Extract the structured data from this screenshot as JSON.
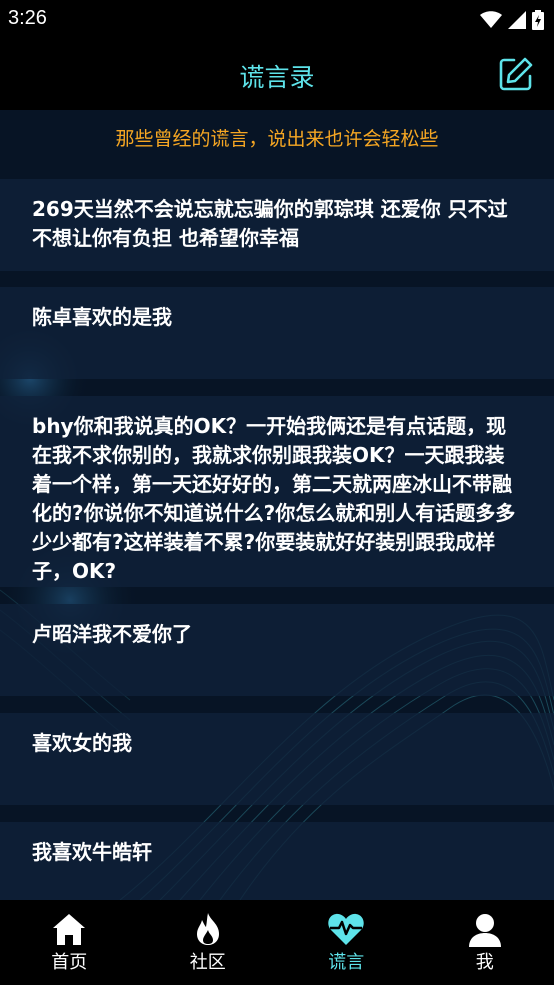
{
  "status_bar": {
    "time": "3:26"
  },
  "header": {
    "title": "谎言录",
    "edit_icon": "edit-square-icon"
  },
  "subtitle": "那些曾经的谎言，说出来也许会轻松些",
  "lies": [
    {
      "text": "269天当然不会说忘就忘骗你的郭琮琪 还爱你 只不过不想让你有负担 也希望你幸福"
    },
    {
      "text": "陈卓喜欢的是我"
    },
    {
      "text": "bhy你和我说真的OK？一开始我俩还是有点话题，现在我不求你别的，我就求你别跟我装OK？一天跟我装着一个样，第一天还好好的，第二天就两座冰山不带融化的?你说你不知道说什么?你怎么就和别人有话题多多少少都有?这样装着不累?你要装就好好装别跟我成样子，OK?"
    },
    {
      "text": "卢昭洋我不爱你了"
    },
    {
      "text": "喜欢女的我"
    },
    {
      "text": "我喜欢牛皓轩"
    }
  ],
  "tabs": [
    {
      "label": "首页",
      "icon": "home-icon",
      "active": false
    },
    {
      "label": "社区",
      "icon": "fire-icon",
      "active": false
    },
    {
      "label": "谎言",
      "icon": "heart-pulse-icon",
      "active": true
    },
    {
      "label": "我",
      "icon": "user-icon",
      "active": false
    }
  ],
  "colors": {
    "accent": "#5ee3ea",
    "subtitle": "#f5a623",
    "background": "#071425",
    "card": "#10213a",
    "tab_inactive": "#ffffff"
  }
}
